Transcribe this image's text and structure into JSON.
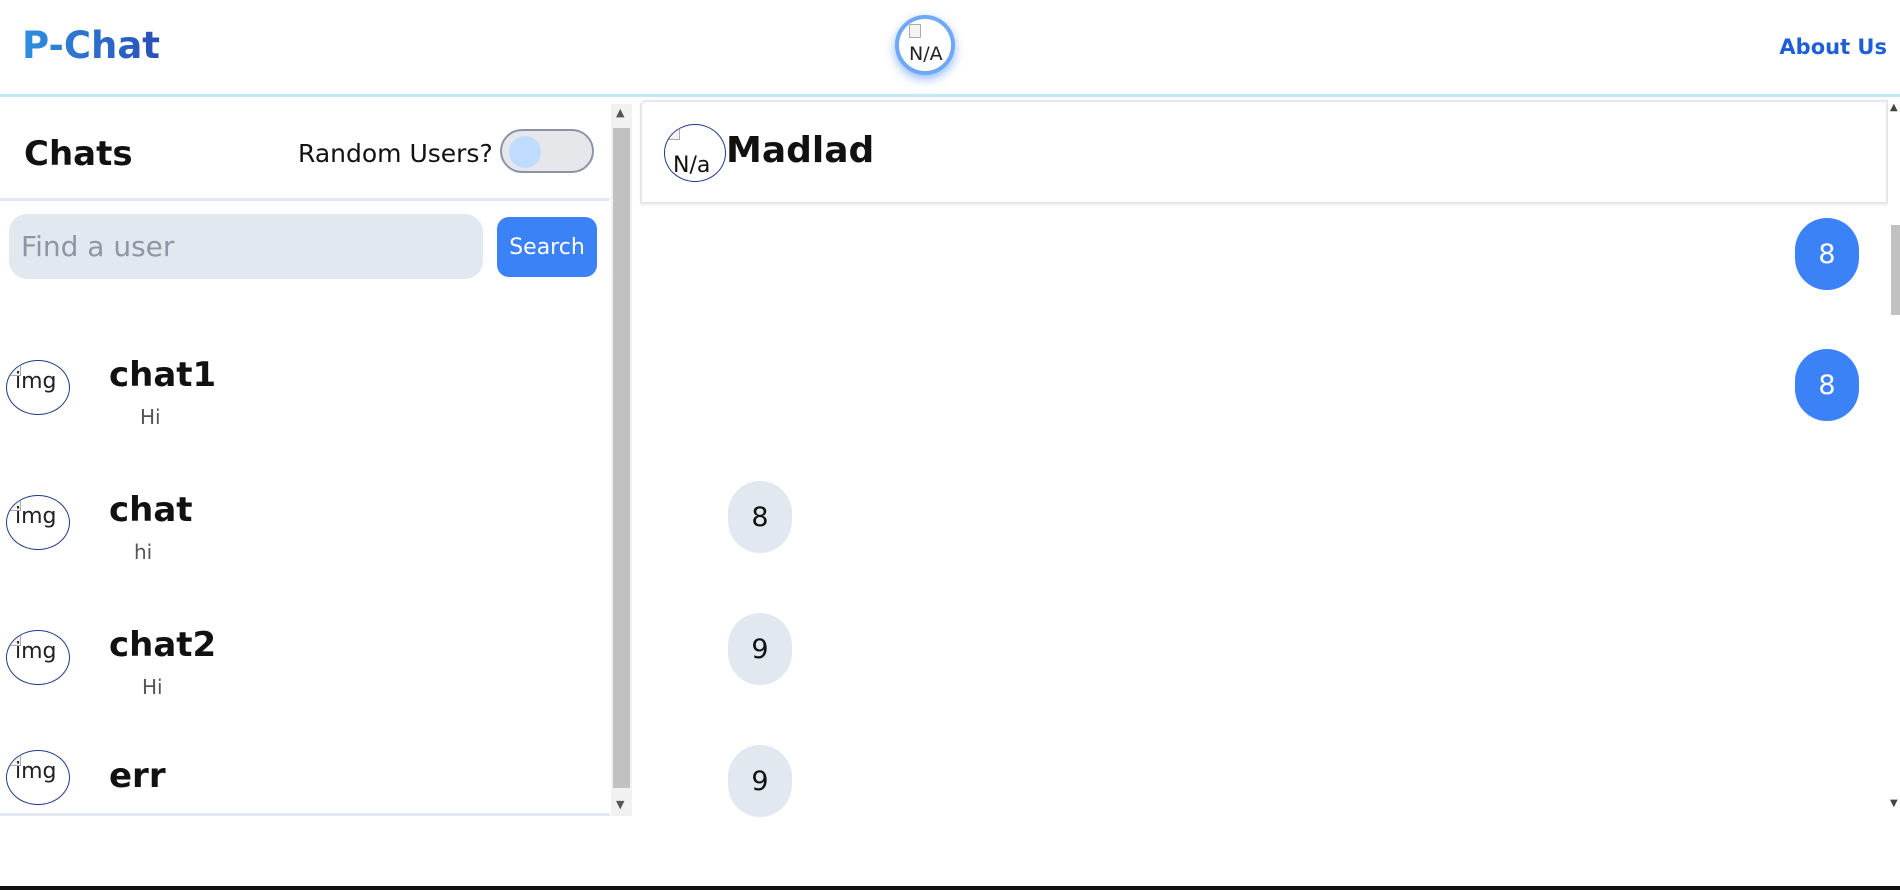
{
  "header": {
    "brand": "P-Chat",
    "profile_alt": "N/A",
    "about_label": "About Us"
  },
  "sidebar": {
    "title": "Chats",
    "random_users_label": "Random Users?",
    "random_users_enabled": false,
    "search": {
      "placeholder": "Find a user",
      "value": "",
      "button_label": "Search"
    },
    "chats": [
      {
        "name": "chat1",
        "last_message": "Hi",
        "avatar_alt": "img"
      },
      {
        "name": "chat",
        "last_message": "hi",
        "avatar_alt": "img"
      },
      {
        "name": "chat2",
        "last_message": "Hi",
        "avatar_alt": "img"
      },
      {
        "name": "err",
        "last_message": "",
        "avatar_alt": "img"
      }
    ]
  },
  "conversation": {
    "avatar_alt": "N/a",
    "contact_name": "Madlad",
    "messages": [
      {
        "text": "8",
        "from": "me"
      },
      {
        "text": "8",
        "from": "me"
      },
      {
        "text": "8",
        "from": "them"
      },
      {
        "text": "9",
        "from": "them"
      },
      {
        "text": "9",
        "from": "them"
      }
    ]
  },
  "colors": {
    "accent": "#3b82f6",
    "incoming_bubble": "#e2e8f0",
    "header_border": "#bfe9f6"
  }
}
